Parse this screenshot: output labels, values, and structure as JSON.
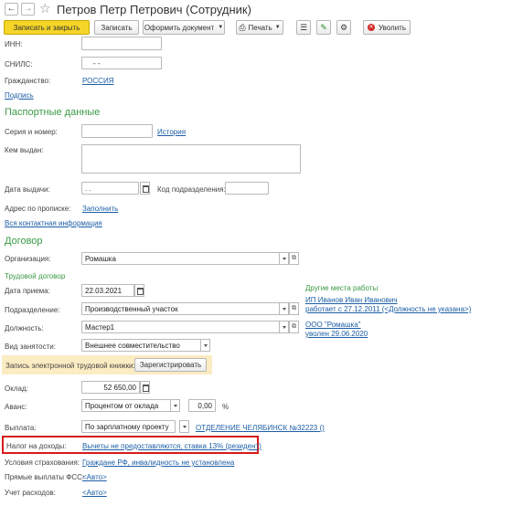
{
  "window": {
    "title": "Петров Петр Петрович (Сотрудник)"
  },
  "toolbar": {
    "save_close": "Записать и закрыть",
    "save": "Записать",
    "document": "Оформить документ",
    "print": "Печать",
    "fire": "Уволить"
  },
  "fields": {
    "inn_label": "ИНН:",
    "inn_value": "",
    "snils_label": "СНИЛС:",
    "snils_value": "-   -",
    "citizenship_label": "Гражданство:",
    "citizenship_value": "РОССИЯ",
    "sign_link": "Подпись"
  },
  "passport": {
    "title": "Паспортные данные",
    "series_label": "Серия и номер:",
    "history_link": "История",
    "issued_by_label": "Кем выдан:",
    "issue_date_label": "Дата выдачи:",
    "issue_date_value": " .  .",
    "dept_code_label": "Код подразделения:",
    "address_label": "Адрес по прописке:",
    "fill_link": "Заполнить",
    "contacts_link": "Вся контактная информация"
  },
  "contract": {
    "title": "Договор",
    "org_label": "Организация:",
    "org_value": "Ромашка",
    "labor_title": "Трудовой договор",
    "hire_date_label": "Дата приема:",
    "hire_date_value": "22.03.2021",
    "dept_label": "Подразделение:",
    "dept_value": "Производственный участок",
    "position_label": "Должность:",
    "position_value": "Мастер1",
    "emp_type_label": "Вид занятости:",
    "emp_type_value": "Внешнее совместительство",
    "other_title": "Другие места работы",
    "other1_line1": "ИП Иванов Иван Иванович",
    "other1_line2": "работает с 27.12.2011 (<Должность не указана>)",
    "other2_line1": "ООО \"Ромашка\"",
    "other2_line2": "уволен 29.06.2020",
    "ebook_label": "Запись электронной трудовой книжки:",
    "ebook_button": "Зарегистрировать",
    "salary_label": "Оклад:",
    "salary_value": "52 650,00",
    "advance_label": "Аванс:",
    "advance_type": "Процентом от оклада",
    "advance_value": "0,00",
    "advance_unit": "%",
    "payout_label": "Выплата:",
    "payout_value": "По зарплатному проекту",
    "payout_link": "ОТДЕЛЕНИЕ ЧЕЛЯБИНСК №32223 ()",
    "tax_label": "Налог на доходы:",
    "tax_link": "Вычеты не предоставляются, ставка 13% (резидент)",
    "insurance_label": "Условия страхования:",
    "insurance_link": "Граждане РФ, инвалидность не установлена",
    "fss_label": "Прямые выплаты ФСС:",
    "fss_link": "<Авто>",
    "expense_label": "Учет расходов:",
    "expense_link": "<Авто>"
  }
}
